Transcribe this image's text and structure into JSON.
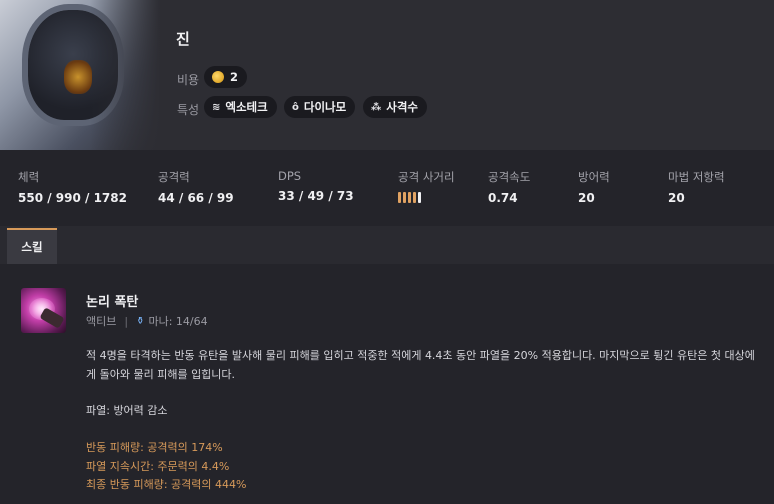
{
  "champion": {
    "name": "진",
    "cost_label": "비용",
    "cost_value": "2",
    "traits_label": "특성",
    "traits": [
      {
        "icon": "hexagon-wave-icon",
        "label": "엑소테크"
      },
      {
        "icon": "dynamo-icon",
        "label": "다이나모"
      },
      {
        "icon": "marksman-icon",
        "label": "사격수"
      }
    ]
  },
  "stats": [
    {
      "label": "체력",
      "value": "550 / 990 / 1782"
    },
    {
      "label": "공격력",
      "value": "44 / 66 / 99"
    },
    {
      "label": "DPS",
      "value": "33 / 49 / 73"
    },
    {
      "label": "공격 사거리",
      "range_level": 4,
      "range_max": 5
    },
    {
      "label": "공격속도",
      "value": "0.74"
    },
    {
      "label": "방어력",
      "value": "20"
    },
    {
      "label": "마법 저항력",
      "value": "20"
    }
  ],
  "tabs": [
    {
      "label": "스킬",
      "active": true
    }
  ],
  "skill": {
    "name": "논리 폭탄",
    "type": "액티브",
    "separator": "|",
    "mana": "마나: 14/64",
    "description": "적 4명을 타격하는 반동 유탄을 발사해 물리 피해를 입히고 적중한 적에게 4.4초 동안 파열을 20% 적용합니다. 마지막으로 튕긴 유탄은 첫 대상에게 돌아와 물리 피해를 입힙니다.",
    "effect": "파열: 방어력 감소",
    "scalings": [
      "반동 피해량: 공격력의 174%",
      "파열 지속시간: 주문력의 4.4%",
      "최종 반동 피해량: 공격력의 444%"
    ]
  },
  "colors": {
    "accent": "#d79a5a",
    "background": "#24242a",
    "header": "#2d2d33",
    "mana": "#7bb8ff"
  }
}
